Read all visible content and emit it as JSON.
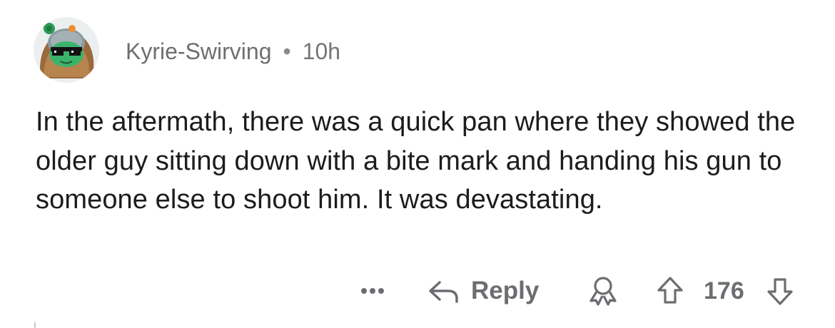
{
  "comment": {
    "author": "Kyrie-Swirving",
    "separator": "•",
    "time": "10h",
    "body": "In the aftermath, there was a quick pan where they showed the older guy sitting down with a bite mark and handing his gun to someone else to shoot him. It was devastating.",
    "actions": {
      "more_icon": "ellipsis-icon",
      "reply_icon": "reply-arrow-icon",
      "reply_label": "Reply",
      "award_icon": "award-ribbon-icon",
      "upvote_icon": "upvote-arrow-icon",
      "score": "176",
      "downvote_icon": "downvote-arrow-icon"
    }
  },
  "colors": {
    "text": "#1c1c1c",
    "meta": "#737577",
    "icon": "#6b6d70"
  }
}
